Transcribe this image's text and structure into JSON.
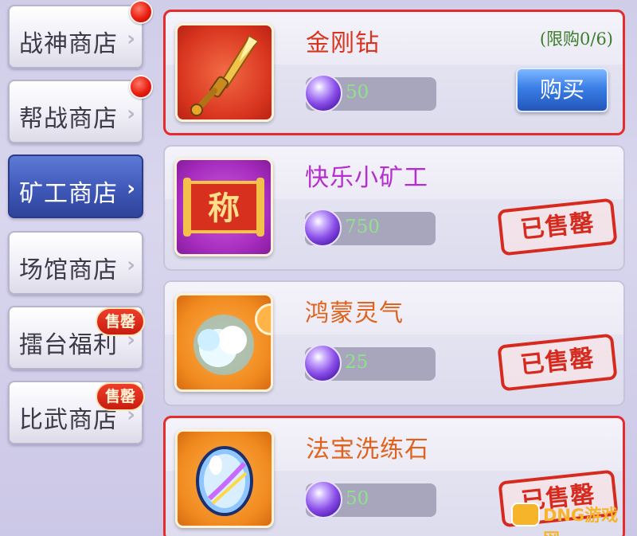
{
  "sidebar": {
    "tabs": [
      {
        "label": "战神商店",
        "active": false,
        "badge": "dot"
      },
      {
        "label": "帮战商店",
        "active": false,
        "badge": "dot"
      },
      {
        "label": "矿工商店",
        "active": true,
        "badge": ""
      },
      {
        "label": "场馆商店",
        "active": false,
        "badge": ""
      },
      {
        "label": "擂台福利",
        "active": false,
        "badge": "售罄"
      },
      {
        "label": "比武商店",
        "active": false,
        "badge": "售罄"
      }
    ],
    "arrow": "›"
  },
  "items": [
    {
      "name": "金刚钻",
      "name_color": "#d8341e",
      "limit": "(限购0/6)",
      "price": "50",
      "action": "购买",
      "sold_out": false,
      "icon": "drill-icon",
      "frame": "red"
    },
    {
      "name": "快乐小矿工",
      "name_color": "#b52ccf",
      "limit": "",
      "price": "750",
      "action": "已售罄",
      "sold_out": true,
      "icon": "title-scroll-icon",
      "scroll_text": "称",
      "frame": "purple"
    },
    {
      "name": "鸿蒙灵气",
      "name_color": "#e0621b",
      "limit": "",
      "price": "25",
      "action": "已售罄",
      "sold_out": true,
      "icon": "aura-cloud-icon",
      "frame": "orange"
    },
    {
      "name": "法宝洗练石",
      "name_color": "#e0621b",
      "limit": "",
      "price": "50",
      "action": "已售罄",
      "sold_out": true,
      "icon": "refining-stone-icon",
      "frame": "orange"
    }
  ],
  "currency_icon": "purple-gem-icon",
  "watermark": {
    "text": "DNG游戏网"
  },
  "colors": {
    "highlight_border": "#e52b2b",
    "active_tab": "#3f58b8",
    "price_text": "#8fe28a"
  }
}
